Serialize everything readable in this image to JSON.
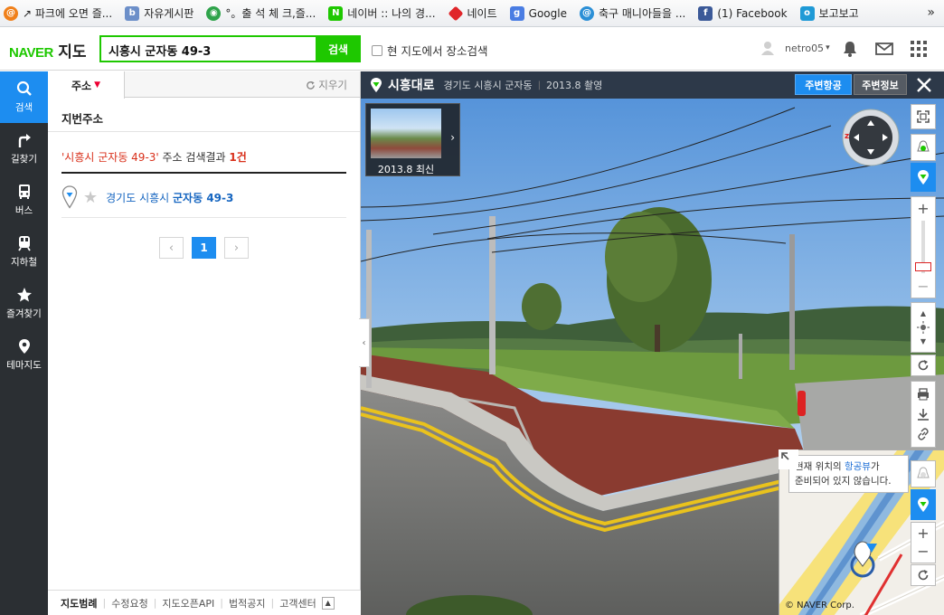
{
  "bookmarks": [
    {
      "label": "↗ 파크에 오면 즐...",
      "icon": "swirl-icon",
      "color": "#f0801a"
    },
    {
      "label": "자유게시판",
      "icon": "board-icon",
      "color": "#6c8fc9"
    },
    {
      "label": "°。출 석 체 크,즐...",
      "icon": "check-circle-icon",
      "color": "#2ea34a"
    },
    {
      "label": "네이버 :: 나의 경...",
      "icon": "naver-n-icon",
      "color": "#1ec800"
    },
    {
      "label": "네이트",
      "icon": "nate-icon",
      "color": "#e0262a"
    },
    {
      "label": "Google",
      "icon": "google-icon",
      "color": "#4a7de3"
    },
    {
      "label": "축구 매니아들을 ...",
      "icon": "swirl-blue-icon",
      "color": "#2b8fd6"
    },
    {
      "label": "(1) Facebook",
      "icon": "facebook-icon",
      "color": "#3b5998"
    },
    {
      "label": "보고보고",
      "icon": "bogo-icon",
      "color": "#1f9ad6"
    }
  ],
  "bookmarks_more": "»",
  "header": {
    "logo_naver": "NAVER",
    "logo_map": "지도",
    "search_value": "시흥시 군자동 49-3",
    "search_button": "검색",
    "local_search_label": "현 지도에서 장소검색",
    "username": "netro05",
    "user_caret": "▾"
  },
  "leftnav": [
    {
      "label": "검색",
      "icon": "search-icon"
    },
    {
      "label": "길찾기",
      "icon": "directions-icon"
    },
    {
      "label": "버스",
      "icon": "bus-icon"
    },
    {
      "label": "지하철",
      "icon": "subway-icon"
    },
    {
      "label": "즐겨찾기",
      "icon": "star-icon"
    },
    {
      "label": "테마지도",
      "icon": "location-pin-icon"
    }
  ],
  "panel": {
    "tab_label": "주소",
    "tab_caret": "▼",
    "clear_label": "지우기",
    "section_title": "지번주소",
    "summary_query": "'시흥시 군자동 49-3'",
    "summary_text": " 주소 검색결과 ",
    "summary_count": "1건",
    "result_region": "경기도 시흥시 ",
    "result_highlight": "군자동 49-3",
    "pager_prev": "‹",
    "pager_current": "1",
    "pager_next": "›",
    "collapse_arrow": "‹"
  },
  "footer": {
    "items": [
      "지도범례",
      "수정요청",
      "지도오픈API",
      "법적공지",
      "고객센터"
    ],
    "sep": "|",
    "up": "▲"
  },
  "streetview": {
    "road_name": "시흥대로",
    "location": "경기도 시흥시 군자동",
    "sep": "|",
    "date": "2013.8 촬영",
    "btn_aerial": "주변항공",
    "btn_info": "주변정보",
    "thumb_date": "2013.8 최신",
    "thumb_arrow": "›",
    "compass_n": "z",
    "zoom_in": "+",
    "zoom_out": "−",
    "up": "▲",
    "down": "▼",
    "mini_zoom_in": "+",
    "mini_zoom_out": "−",
    "tip_line1_a": "현재 위치의 ",
    "tip_line1_b": "항공뷰",
    "tip_line1_c": "가",
    "tip_line2": "준비되어 있지 않습니다.",
    "copyright": "© NAVER Corp."
  },
  "colors": {
    "brand_green": "#1ec800",
    "accent_blue": "#1d8df0",
    "nav_bg": "#2b2f33",
    "highlight_red": "#d9301b"
  }
}
